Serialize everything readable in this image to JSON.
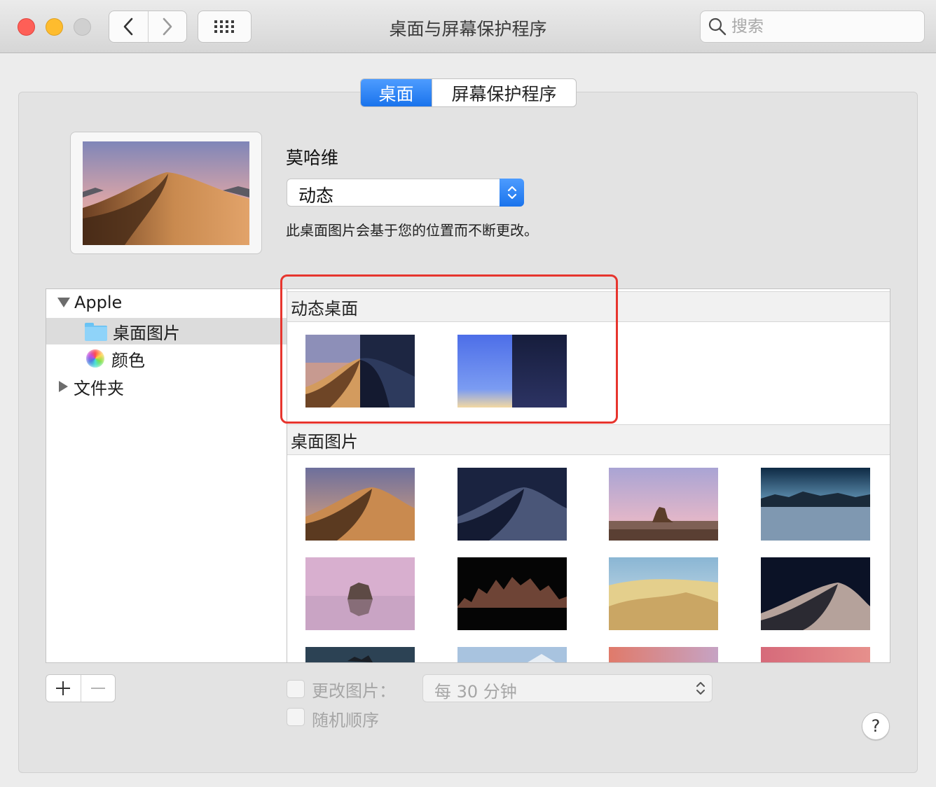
{
  "window": {
    "title": "桌面与屏幕保护程序"
  },
  "search": {
    "placeholder": "搜索"
  },
  "tabs": [
    {
      "label": "桌面"
    },
    {
      "label": "屏幕保护程序"
    }
  ],
  "wallpaper": {
    "name": "莫哈维",
    "mode": "动态",
    "description": "此桌面图片会基于您的位置而不断更改。"
  },
  "sidebar": {
    "apple_label": "Apple",
    "desktop_pictures_label": "桌面图片",
    "colors_label": "颜色",
    "folders_label": "文件夹"
  },
  "content": {
    "dynamic_section_title": "动态桌面",
    "pictures_section_title": "桌面图片"
  },
  "bottom": {
    "add_symbol": "+",
    "remove_symbol": "—",
    "change_picture_label": "更改图片：",
    "interval": "每 30 分钟",
    "random_order_label": "随机顺序",
    "help_symbol": "?"
  },
  "colors": {
    "accent": "#1a73ec",
    "highlight": "#e7352e"
  }
}
